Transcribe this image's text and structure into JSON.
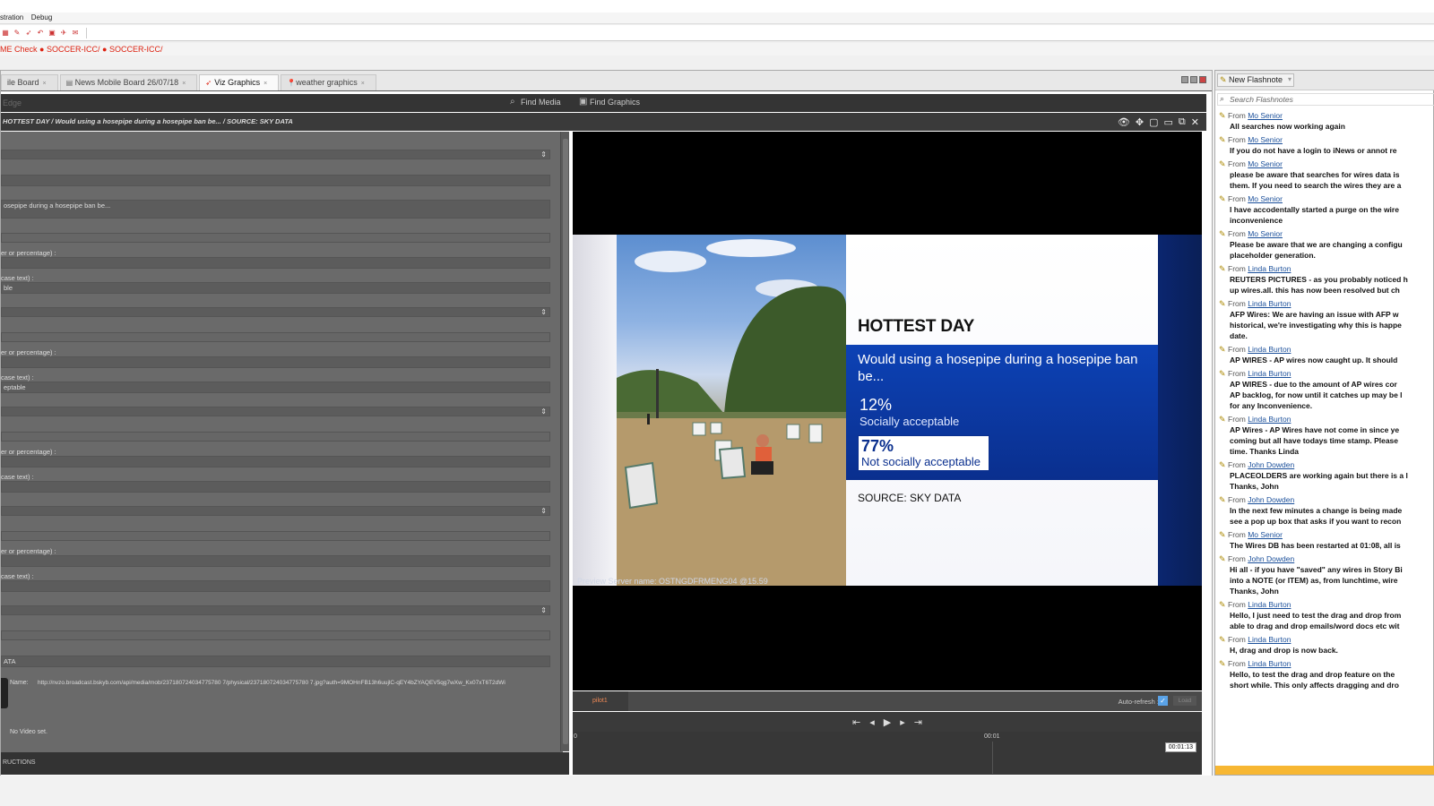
{
  "menu": {
    "items": [
      "stration",
      "Debug"
    ]
  },
  "breadcrumb": {
    "prefix": "ME Check",
    "items": [
      "SOCCER-ICC/",
      "SOCCER-ICC/"
    ]
  },
  "tabs": [
    {
      "label": "ile Board",
      "icon": "board-icon",
      "active": false
    },
    {
      "label": "News Mobile Board 26/07/18",
      "icon": "board-icon",
      "active": false
    },
    {
      "label": "Viz Graphics",
      "icon": "viz-icon",
      "active": true
    },
    {
      "label": "weather graphics",
      "icon": "pin-icon",
      "active": false
    }
  ],
  "subbar": {
    "edge": "Edge",
    "find_media": "Find Media",
    "find_graphics": "Find Graphics"
  },
  "slug": "HOTTEST DAY / Would using a hosepipe during a hosepipe ban be... / SOURCE: SKY DATA",
  "form": {
    "field3": "osepipe during a hosepipe ban be...",
    "label_num": "er or percentage) :",
    "label_case": "case text) :",
    "val1": "ble",
    "val2": "eptable",
    "last_val": "ATA",
    "name_label": "Name:",
    "url": "http://nvzo.broadcast.bskyb.com/api/media/mob/237180724034775780 7/physical/237180724034775780 7.jpg?auth=9MOHnFB13h6uujlC-qEY4bZYAQEV5qg7wXw_Kx07xT6T2dWi",
    "no_video": "No Video set.",
    "instructions": "RUCTIONS"
  },
  "preview": {
    "title": "HOTTEST DAY",
    "question": "Would using a hosepipe during a hosepipe ban be...",
    "answers": [
      {
        "pct": "12%",
        "label": "Socially acceptable"
      },
      {
        "pct": "77%",
        "label": "Not socially acceptable"
      }
    ],
    "source": "SOURCE: SKY DATA",
    "server": "Preview Server name:   OSTNGDFRMENG04   @15.59"
  },
  "player": {
    "tab": "pilot1",
    "auto_refresh": "Auto-refresh :",
    "load": "Load",
    "time_start": "0",
    "time_mid": "00:01",
    "timecode": "00:01:13"
  },
  "flashnotes": {
    "new_button": "New Flashnote",
    "search_placeholder": "Search Flashnotes",
    "notes": [
      {
        "from": "Mo Senior",
        "lines": [
          "All searches now working again"
        ]
      },
      {
        "from": "Mo Senior",
        "lines": [
          "If you do not have a login to iNews or annot re"
        ]
      },
      {
        "from": "Mo Senior",
        "lines": [
          "please be aware that searches for wires data is",
          "them. If you need to search the wires they are a"
        ]
      },
      {
        "from": "Mo Senior",
        "lines": [
          "I have accodentally started a purge on the wire",
          "inconvenience"
        ]
      },
      {
        "from": "Mo Senior",
        "lines": [
          "Please be aware that we are changing a configu",
          "placeholder generation."
        ]
      },
      {
        "from": "Linda Burton",
        "lines": [
          "REUTERS PICTURES - as you probably noticed h",
          "up wires.all. this has now been resolved but ch"
        ]
      },
      {
        "from": "Linda Burton",
        "lines": [
          "AFP Wires:   We are having an issue with AFP w",
          "historical, we're investigating why this is happe",
          "date."
        ]
      },
      {
        "from": "Linda Burton",
        "lines": [
          "AP WIRES -  AP wires now caught up.  It should"
        ]
      },
      {
        "from": "Linda Burton",
        "lines": [
          "AP WIRES -   due to the amount of AP wires cor",
          "AP backlog, for now until it catches up may be l",
          "for any Inconvenience."
        ]
      },
      {
        "from": "Linda Burton",
        "lines": [
          "AP Wires -   AP Wires have not come in since ye",
          "coming but all have todays time stamp.  Please",
          "time.   Thanks Linda"
        ]
      },
      {
        "from": "John Dowden",
        "lines": [
          "PLACEOLDERS are working again but there is a l",
          "Thanks, John"
        ]
      },
      {
        "from": "John Dowden",
        "lines": [
          "In the next few minutes a change is being made",
          "see a pop up box that asks if you want to recon"
        ]
      },
      {
        "from": "Mo Senior",
        "lines": [
          "The Wires DB has been restarted at 01:08, all is"
        ]
      },
      {
        "from": "John Dowden",
        "lines": [
          "Hi all - if you have \"saved\" any wires in Story Bi",
          "into a NOTE (or ITEM) as, from lunchtime, wire",
          "Thanks, John"
        ]
      },
      {
        "from": "Linda Burton",
        "lines": [
          "Hello, I just need to test the drag and drop from",
          "able to drag and drop emails/word docs etc wit"
        ]
      },
      {
        "from": "Linda Burton",
        "lines": [
          "H, drag and drop is now back."
        ]
      },
      {
        "from": "Linda Burton",
        "lines": [
          "Hello,  to test the drag and drop feature on the",
          "short while.  This only affects dragging and dro"
        ]
      }
    ]
  },
  "from_label": "From",
  "colors": {
    "accent_blue": "#0b3aa0",
    "breadcrumb_red": "#d21",
    "flash_orange": "#f7b733"
  }
}
